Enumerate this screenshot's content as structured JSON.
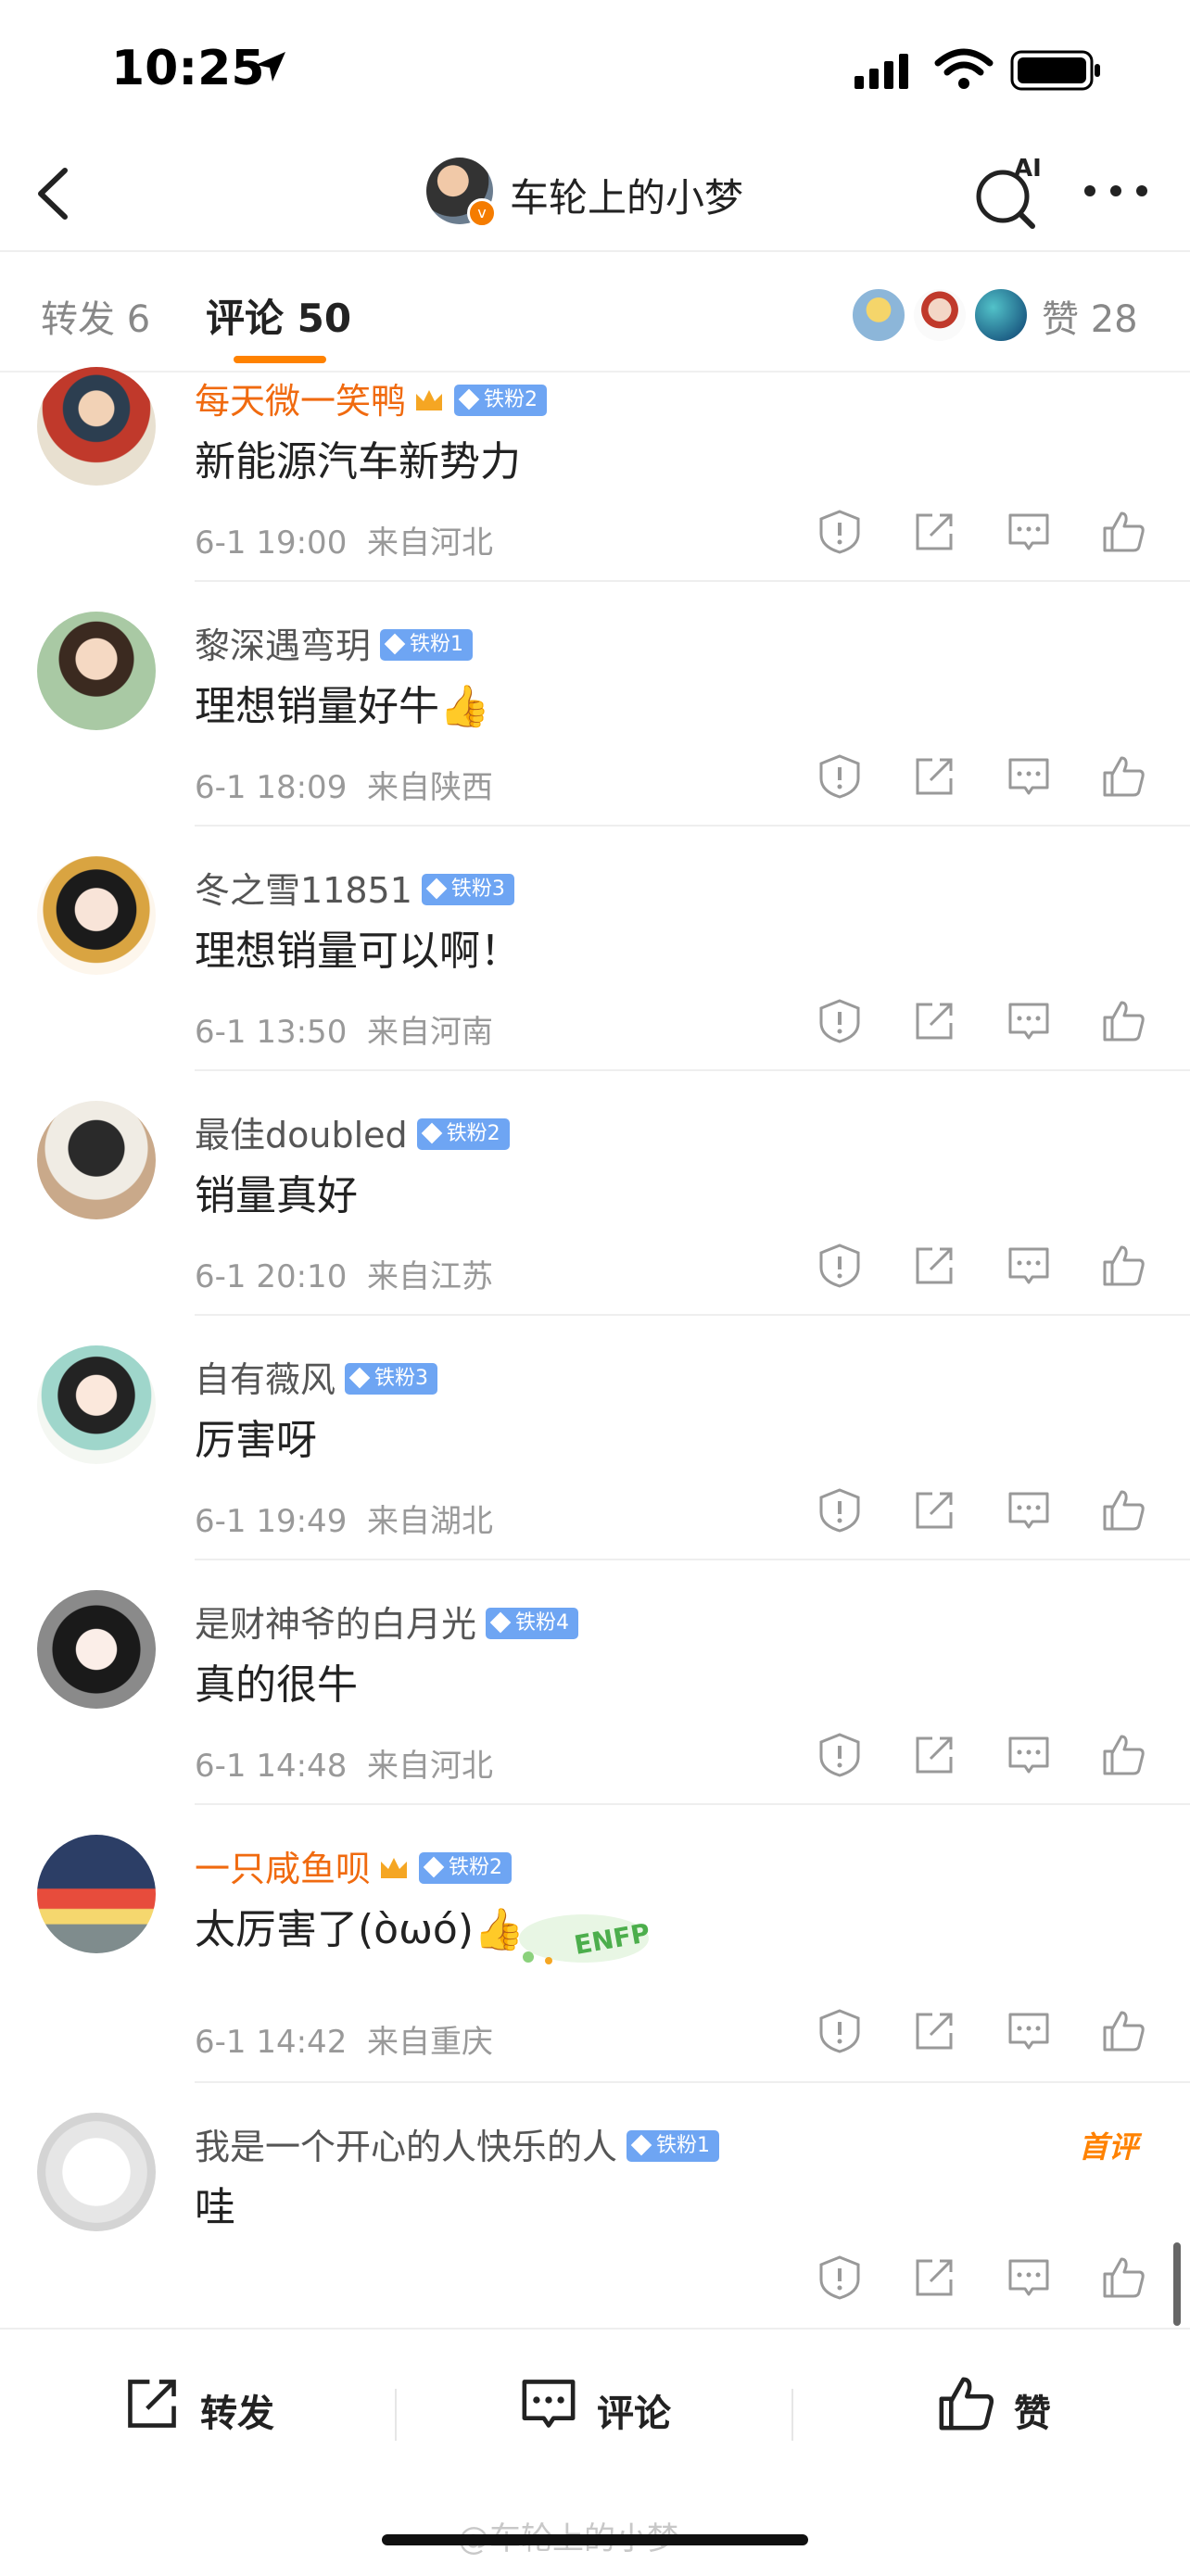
{
  "status_bar": {
    "time": "10:25"
  },
  "nav": {
    "title": "车轮上的小梦",
    "ai_label": "AI"
  },
  "tabs": {
    "forward_label": "转发 6",
    "comment_label": "评论 50",
    "like_label": "赞 28"
  },
  "colors": {
    "accent": "#ff8200",
    "vip_name": "#f06a0f",
    "fan_badge": "#6ea5f3"
  },
  "comments": [
    {
      "name": "每天微一笑鸭",
      "badge": "铁粉2",
      "vip": true,
      "text": "新能源汽车新势力",
      "time": "6-1 19:00",
      "location": "来自河北"
    },
    {
      "name": "黎深遇弯玥",
      "badge": "铁粉1",
      "vip": false,
      "text": "理想销量好牛👍",
      "time": "6-1 18:09",
      "location": "来自陕西"
    },
    {
      "name": "冬之雪11851",
      "badge": "铁粉3",
      "vip": false,
      "text": "理想销量可以啊！",
      "time": "6-1 13:50",
      "location": "来自河南"
    },
    {
      "name": "最佳doubled",
      "badge": "铁粉2",
      "vip": false,
      "text": "销量真好",
      "time": "6-1 20:10",
      "location": "来自江苏"
    },
    {
      "name": "自有薇风",
      "badge": "铁粉3",
      "vip": false,
      "text": "厉害呀",
      "time": "6-1 19:49",
      "location": "来自湖北"
    },
    {
      "name": "是财神爷的白月光",
      "badge": "铁粉4",
      "vip": false,
      "text": "真的很牛",
      "time": "6-1 14:48",
      "location": "来自河北"
    },
    {
      "name": "一只咸鱼呗",
      "badge": "铁粉2",
      "vip": true,
      "text": "太厉害了(òωó)👍",
      "time": "6-1 14:42",
      "location": "来自重庆",
      "sticker": "ENFP"
    },
    {
      "name": "我是一个开心的人快乐的人",
      "badge": "铁粉1",
      "vip": false,
      "text": "哇",
      "first_tag": "首评"
    }
  ],
  "bottom_bar": {
    "forward": "转发",
    "comment": "评论",
    "like": "赞"
  },
  "watermark": "@车轮上的小梦"
}
